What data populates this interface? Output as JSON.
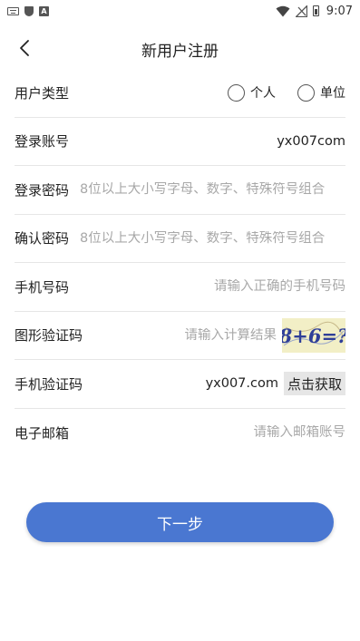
{
  "status_bar": {
    "time": "9:07"
  },
  "header": {
    "title": "新用户注册"
  },
  "form": {
    "user_type": {
      "label": "用户类型",
      "options": [
        "个人",
        "单位"
      ]
    },
    "login_account": {
      "label": "登录账号",
      "value": "yx007com"
    },
    "login_password": {
      "label": "登录密码",
      "placeholder": "8位以上大小写字母、数字、特殊符号组合"
    },
    "confirm_password": {
      "label": "确认密码",
      "placeholder": "8位以上大小写字母、数字、特殊符号组合"
    },
    "phone": {
      "label": "手机号码",
      "placeholder": "请输入正确的手机号码"
    },
    "captcha": {
      "label": "图形验证码",
      "placeholder": "请输入计算结果",
      "image_text": "8+6=?"
    },
    "sms_code": {
      "label": "手机验证码",
      "value": "yx007.com",
      "button_label": "点击获取"
    },
    "email": {
      "label": "电子邮箱",
      "placeholder": "请输入邮箱账号"
    }
  },
  "next_button": {
    "label": "下一步"
  },
  "colors": {
    "primary": "#4a77d1",
    "divider": "#e6e6e6",
    "placeholder": "#a8a8a8"
  }
}
